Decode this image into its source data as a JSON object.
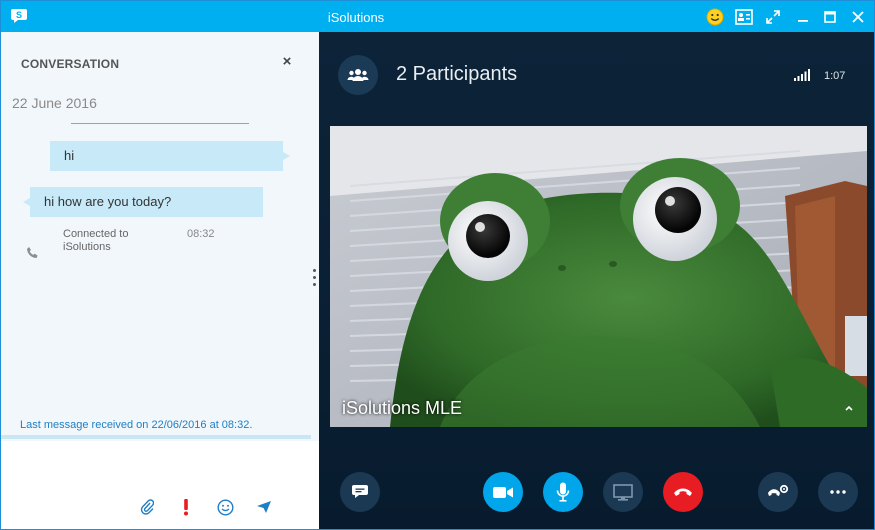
{
  "window": {
    "title": "iSolutions"
  },
  "conversation": {
    "header": "CONVERSATION",
    "close_label": "×",
    "date": "22 June 2016",
    "messages": [
      {
        "direction": "outgoing",
        "text": "hi"
      },
      {
        "direction": "incoming",
        "text": "hi how are you today?"
      }
    ],
    "call_event": {
      "text": "Connected to iSolutions",
      "time": "08:32",
      "icon": "phone-icon"
    },
    "last_message": "Last message received on 22/06/2016 at 08:32.",
    "compose_actions": [
      "attach-file-icon",
      "high-importance-icon",
      "emoticon-icon",
      "send-icon"
    ]
  },
  "call": {
    "participants_label": "2 Participants",
    "timer": "1:07",
    "video_caption": "iSolutions MLE",
    "controls": [
      "show-conversation",
      "video",
      "microphone",
      "share-screen",
      "end-call",
      "dial-pad",
      "more-options"
    ]
  },
  "colors": {
    "titlebar": "#00aff0",
    "accent_blue": "#00a5ea",
    "end_call_red": "#e81c23",
    "bubble": "#c7e9f8",
    "link": "#1f7fc4"
  }
}
